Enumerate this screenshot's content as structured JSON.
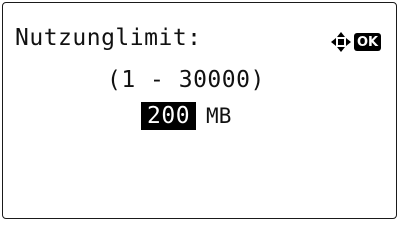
{
  "screen": {
    "title": "Nutzunglimit:",
    "range": "(1 - 30000)",
    "value": "200",
    "unit": "MB"
  },
  "nav": {
    "arrows_icon": "four-way-arrows-icon",
    "ok_label": "OK"
  }
}
